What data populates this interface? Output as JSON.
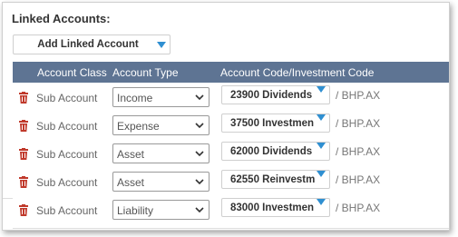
{
  "panel": {
    "title": "Linked Accounts:",
    "add_button_label": "Add Linked Account"
  },
  "table": {
    "headers": {
      "account_class": "Account Class",
      "account_type": "Account Type",
      "account_code": "Account Code/Investment Code"
    },
    "rows": [
      {
        "account_class": "Sub Account",
        "account_type": "Income",
        "account_code": "23900 Dividends",
        "investment_code": "/ BHP.AX"
      },
      {
        "account_class": "Sub Account",
        "account_type": "Expense",
        "account_code": "37500 Investmen",
        "investment_code": "/ BHP.AX"
      },
      {
        "account_class": "Sub Account",
        "account_type": "Asset",
        "account_code": "62000 Dividends",
        "investment_code": "/ BHP.AX"
      },
      {
        "account_class": "Sub Account",
        "account_type": "Asset",
        "account_code": "62550 Reinvestm",
        "investment_code": "/ BHP.AX"
      },
      {
        "account_class": "Sub Account",
        "account_type": "Liability",
        "account_code": "83000 Investmen",
        "investment_code": "/ BHP.AX"
      }
    ]
  },
  "colors": {
    "header_bg": "#5e7493",
    "accent_blue": "#2f8fd1",
    "trash_red": "#c0392b"
  }
}
